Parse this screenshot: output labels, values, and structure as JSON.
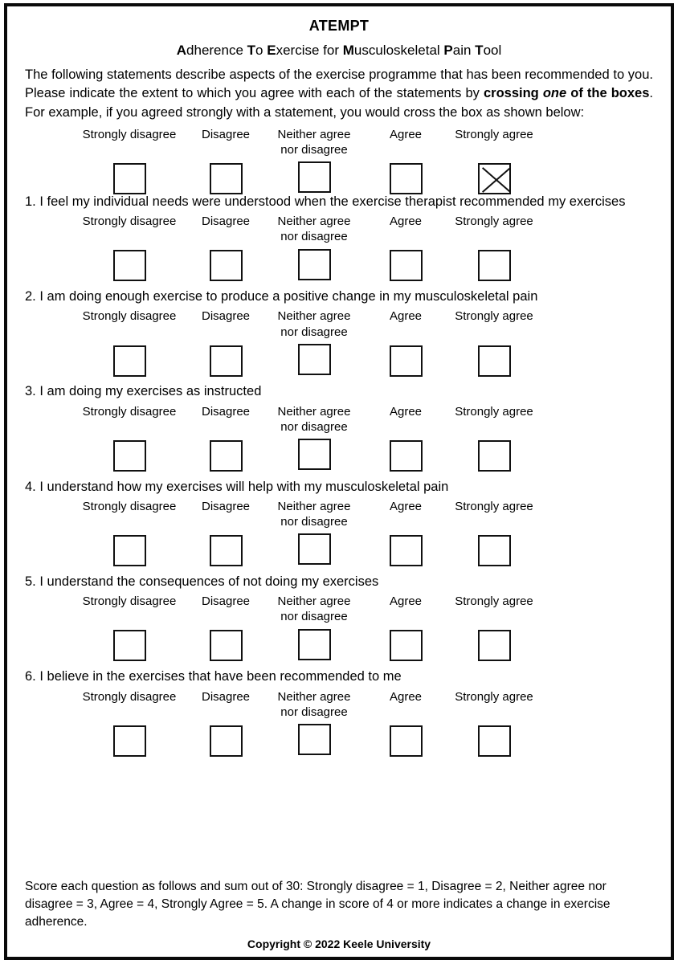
{
  "document": {
    "title": "ATEMPT",
    "subtitle_parts": [
      {
        "text": "A",
        "bold": true
      },
      {
        "text": "dherence ",
        "bold": false
      },
      {
        "text": "T",
        "bold": true
      },
      {
        "text": "o ",
        "bold": false
      },
      {
        "text": "E",
        "bold": true
      },
      {
        "text": "xercise for ",
        "bold": false
      },
      {
        "text": "M",
        "bold": true
      },
      {
        "text": "usculoskeletal ",
        "bold": false
      },
      {
        "text": "P",
        "bold": true
      },
      {
        "text": "ain ",
        "bold": false
      },
      {
        "text": "T",
        "bold": true
      },
      {
        "text": "ool",
        "bold": false
      }
    ],
    "subtitle_plain": "Adherence To Exercise for Musculoskeletal Pain Tool",
    "intro": {
      "segment_1": "The following statements describe aspects of the exercise programme that has been recommended to you.  Please indicate the extent to which you agree with each of the statements by ",
      "segment_bold_1": "crossing ",
      "segment_bold_italic": "one",
      "segment_bold_2": " of the boxes",
      "segment_2": ". For example, if you agreed strongly with a statement, you would cross the box as shown below:"
    }
  },
  "scale": {
    "options": [
      {
        "label": "Strongly disagree",
        "score": 1
      },
      {
        "label": "Disagree",
        "score": 2
      },
      {
        "label": "Neither agree nor disagree",
        "score": 3
      },
      {
        "label": "Agree",
        "score": 4
      },
      {
        "label": "Strongly agree",
        "score": 5
      }
    ],
    "option_labels_line1": [
      "Strongly disagree",
      "Disagree",
      "Neither agree",
      "Agree",
      "Strongly agree"
    ],
    "option_labels_line2": [
      "",
      "",
      "nor disagree",
      "",
      ""
    ],
    "example_checked_index": 4,
    "example_checked_label": "Strongly agree"
  },
  "questions": [
    {
      "number": "1.",
      "text": "1. I feel my individual needs were understood when the exercise therapist recommended my exercises",
      "answer": null
    },
    {
      "number": "2.",
      "text": "2. I am doing enough exercise to produce a positive change in my musculoskeletal pain",
      "answer": null
    },
    {
      "number": "3.",
      "text": "3. I am doing my exercises as instructed",
      "answer": null
    },
    {
      "number": "4.",
      "text": "4. I understand how my exercises will help with my musculoskeletal pain",
      "answer": null
    },
    {
      "number": "5.",
      "text": "5. I understand the consequences of not doing my exercises",
      "answer": null
    },
    {
      "number": "6.",
      "text": "6. I believe in the exercises that have been recommended to me",
      "answer": null
    }
  ],
  "footer": {
    "scoring": "Score each question as follows and sum out of 30: Strongly disagree = 1, Disagree = 2, Neither agree nor disagree = 3, Agree = 4, Strongly Agree = 5.  A change in score of 4 or more indicates a change in exercise adherence.",
    "copyright": "Copyright © 2022 Keele University"
  },
  "colors": {
    "ink": "#000000",
    "border": "#0a0a0a",
    "box_border": "#111111",
    "background": "#ffffff"
  }
}
